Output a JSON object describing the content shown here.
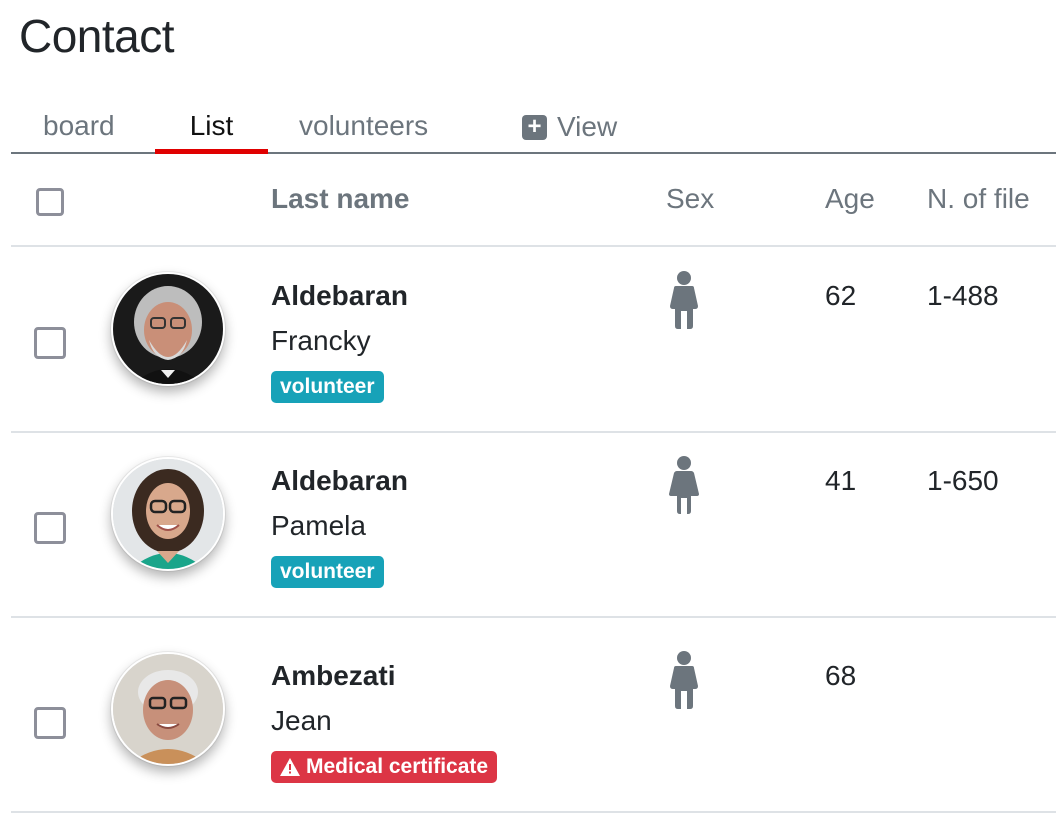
{
  "page": {
    "title": "Contact"
  },
  "tabs": [
    {
      "label": "board",
      "active": false
    },
    {
      "label": "List",
      "active": true
    },
    {
      "label": "volunteers",
      "active": false
    },
    {
      "label": "View",
      "icon": "plus-square-icon",
      "active": false
    }
  ],
  "table": {
    "headers": {
      "last_name": "Last name",
      "sex": "Sex",
      "age": "Age",
      "file": "N. of file"
    },
    "rows": [
      {
        "last_name": "Aldebaran",
        "first_name": "Francky",
        "badge": "volunteer",
        "badge_type": "volunteer",
        "sex_icon": "male-icon",
        "age": "62",
        "file": "1-488"
      },
      {
        "last_name": "Aldebaran",
        "first_name": "Pamela",
        "badge": "volunteer",
        "badge_type": "volunteer",
        "sex_icon": "female-icon",
        "age": "41",
        "file": "1-650"
      },
      {
        "last_name": "Ambezati",
        "first_name": "Jean",
        "badge": "Medical certificate",
        "badge_type": "warning",
        "badge_icon": "warning-icon",
        "sex_icon": "male-icon",
        "age": "68",
        "file": ""
      }
    ]
  },
  "colors": {
    "active_tab_underline": "#e00000",
    "volunteer_badge": "#17a2b8",
    "warning_badge": "#dc3545",
    "muted_text": "#6c757d"
  }
}
